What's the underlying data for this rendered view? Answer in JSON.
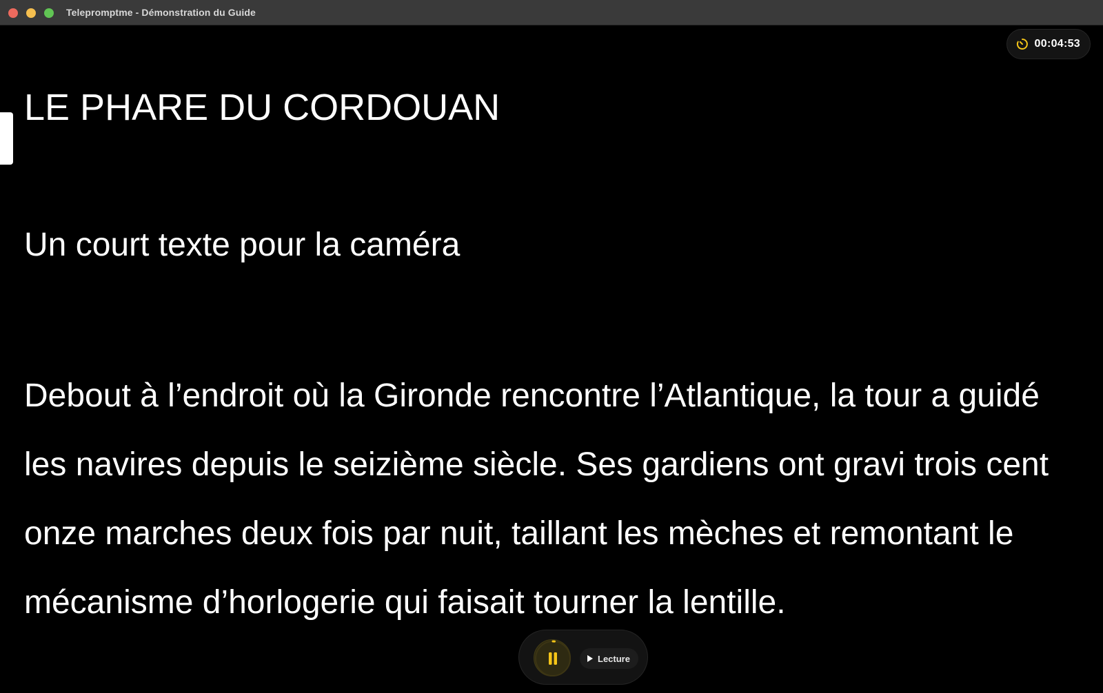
{
  "window": {
    "title": "Telepromptme - Démonstration du Guide"
  },
  "timer": {
    "icon": "timer-icon",
    "value": "00:04:53",
    "accent": "#f5c518"
  },
  "script": {
    "title": "LE PHARE DU CORDOUAN",
    "subtitle": "Un court texte pour la caméra",
    "body_lines": [
      "Debout à l’endroit où la Gironde rencontre l’Atlantique, la tour a guidé",
      "les navires depuis le seizième siècle. Ses gardiens ont gravi trois cent",
      "onze marches deux fois par nuit, taillant les mèches et remontant le",
      "mécanisme d’horlogerie qui faisait tourner la lentille."
    ]
  },
  "controls": {
    "pause_icon": "pause-icon",
    "play_mode_label": "Lecture",
    "play_mode_icon": "play-icon",
    "accent": "#f5c518"
  }
}
